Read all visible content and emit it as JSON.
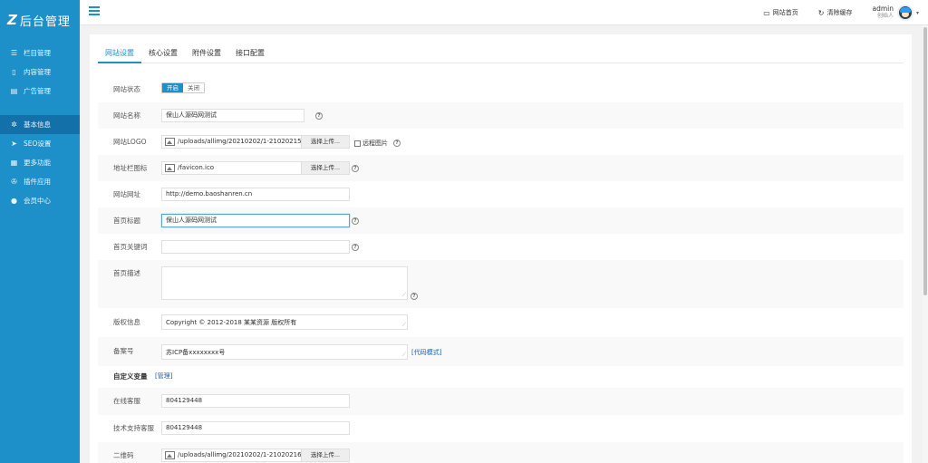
{
  "logo": {
    "mark": "Z",
    "text": "后台管理"
  },
  "sidebar": {
    "group1": [
      {
        "icon": "list-icon",
        "glyph": "☰",
        "label": "栏目管理"
      },
      {
        "icon": "file-icon",
        "glyph": "▯",
        "label": "内容管理"
      },
      {
        "icon": "document-icon",
        "glyph": "▤",
        "label": "广告管理"
      }
    ],
    "group2": [
      {
        "icon": "gear-icon",
        "glyph": "✲",
        "label": "基本信息",
        "active": true
      },
      {
        "icon": "send-icon",
        "glyph": "➤",
        "label": "SEO设置"
      },
      {
        "icon": "grid-icon",
        "glyph": "▦",
        "label": "更多功能"
      },
      {
        "icon": "plugin-icon",
        "glyph": "✇",
        "label": "插件应用"
      },
      {
        "icon": "user-icon",
        "glyph": "●",
        "label": "会员中心"
      }
    ]
  },
  "topbar": {
    "home_label": "网站首页",
    "clear_cache_label": "清除缓存",
    "user_name": "admin",
    "user_role": "创始人"
  },
  "tabs": [
    "网站设置",
    "核心设置",
    "附件设置",
    "接口配置"
  ],
  "form": {
    "status": {
      "label": "网站状态",
      "on": "开启",
      "off": "关闭"
    },
    "site_name": {
      "label": "网站名称",
      "value": "保山人源码网测试"
    },
    "logo": {
      "label": "网站LOGO",
      "value": "/uploads/allimg/20210202/1-21020215",
      "button": "选择上传...",
      "remote_label": "远程图片"
    },
    "favicon": {
      "label": "地址栏图标",
      "value": "/favicon.ico",
      "button": "选择上传..."
    },
    "site_url": {
      "label": "网站网址",
      "value": "http://demo.baoshanren.cn"
    },
    "home_title": {
      "label": "首页标题",
      "value": "保山人源码网测试"
    },
    "home_keywords": {
      "label": "首页关键词",
      "value": ""
    },
    "home_desc": {
      "label": "首页描述",
      "value": ""
    },
    "copyright": {
      "label": "版权信息",
      "value": "Copyright © 2012-2018 某某资源 版权所有"
    },
    "icp": {
      "label": "备案号",
      "value": "苏ICP备xxxxxxxx号",
      "code_mode": "[代码模式]"
    },
    "custom_vars": {
      "title": "自定义变量",
      "manage": "[管理]"
    },
    "online_service": {
      "label": "在线客服",
      "value": "804129448"
    },
    "tech_support": {
      "label": "技术支持客服",
      "value": "804129448"
    },
    "qrcode": {
      "label": "二维码",
      "value": "/uploads/allimg/20210202/1-21020216",
      "button": "选择上传..."
    }
  },
  "colors": {
    "sidebar": "#1e90c9",
    "sidebar_active": "#1470a8",
    "accent": "#1e90c9"
  }
}
